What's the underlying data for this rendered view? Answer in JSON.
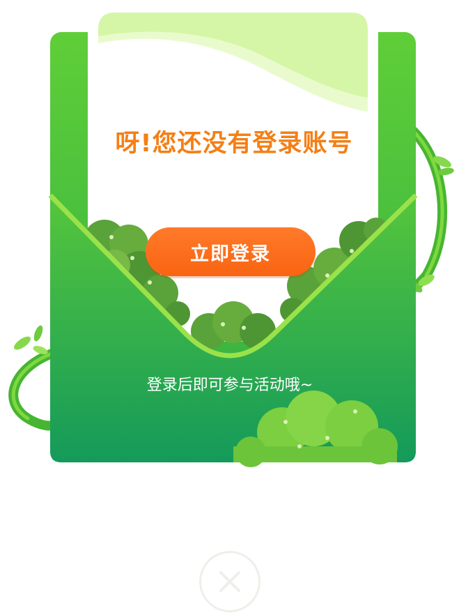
{
  "dialog": {
    "title": "呀!您还没有登录账号",
    "login_button_label": "立即登录",
    "hint": "登录后即可参与活动哦~"
  },
  "colors": {
    "accent_orange": "#f47f16",
    "button_orange": "#fa6a1a",
    "envelope_green": "#3bb44a",
    "light_green": "#d6f5a5",
    "close_ring": "#efefe9"
  },
  "icons": {
    "close": "close-icon"
  }
}
